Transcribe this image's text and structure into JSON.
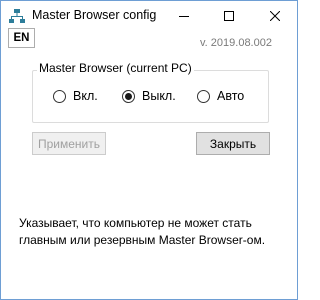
{
  "window": {
    "title": "Master Browser config",
    "accent_color": "#2d7d9a"
  },
  "titlebar": {
    "minimize_icon": "minimize-icon",
    "maximize_icon": "maximize-icon",
    "close_icon": "close-icon"
  },
  "toolbar": {
    "language_button": "EN",
    "version": "v. 2019.08.002"
  },
  "group": {
    "label": "Master Browser (current PC)",
    "options": [
      {
        "label": "Вкл.",
        "selected": false
      },
      {
        "label": "Выкл.",
        "selected": true
      },
      {
        "label": "Авто",
        "selected": false
      }
    ]
  },
  "buttons": {
    "apply_label": "Применить",
    "apply_enabled": false,
    "close_label": "Закрыть"
  },
  "description": "Указывает, что компьютер не может стать главным или резервным Master Browser-ом."
}
